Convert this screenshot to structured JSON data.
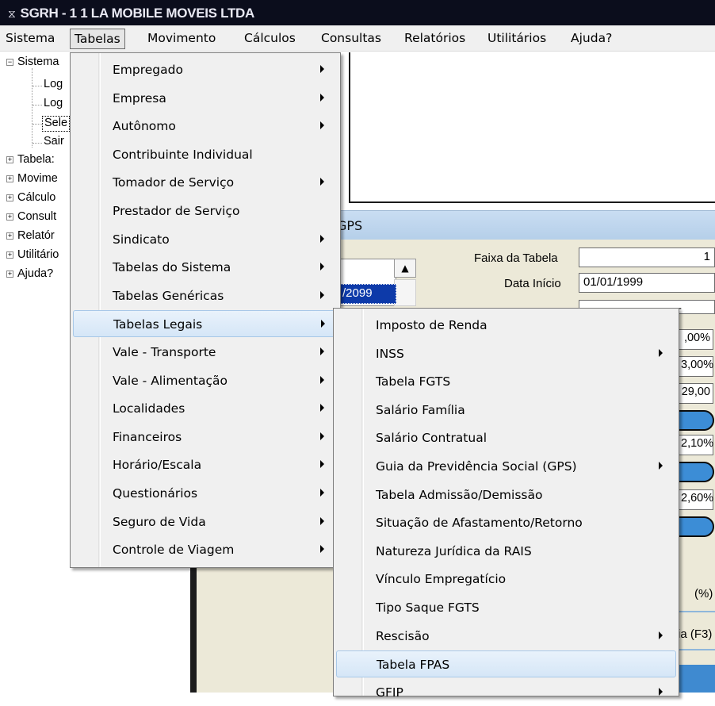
{
  "window": {
    "title": "SGRH - 1 1 LA MOBILE MOVEIS LTDA",
    "icon": "app-icon"
  },
  "menubar": [
    "Sistema",
    "Tabelas",
    "Movimento",
    "Cálculos",
    "Consultas",
    "Relatórios",
    "Utilitários",
    "Ajuda?"
  ],
  "tree": {
    "root": "Sistema",
    "children": [
      "Log",
      "Log",
      "Sele",
      "Sair"
    ],
    "nodes": [
      "Tabela:",
      "Movime",
      "Cálculo",
      "Consult",
      "Relatór",
      "Utilitário",
      "Ajuda?"
    ]
  },
  "gps_window": {
    "title_fragment": "GPS",
    "faixa_label": "Faixa da Tabela",
    "faixa_value": "1",
    "data_inicio_label": "Data Início",
    "data_inicio_value": "01/01/1999",
    "list_selected": "/2099",
    "dash": "-",
    "pct_values": [
      ",00%",
      "3,00%",
      "29,00",
      "2,10%",
      "2,60%"
    ],
    "pct_header": "(%)",
    "f3_button": "ia (F3)"
  },
  "tabelas_menu": {
    "items": [
      {
        "label": "Empregado",
        "submenu": true
      },
      {
        "label": "Empresa",
        "submenu": true
      },
      {
        "label": "Autônomo",
        "submenu": true
      },
      {
        "label": "Contribuinte Individual",
        "submenu": false
      },
      {
        "label": "Tomador de Serviço",
        "submenu": true
      },
      {
        "label": "Prestador de Serviço",
        "submenu": false
      },
      {
        "label": "Sindicato",
        "submenu": true
      },
      {
        "label": "Tabelas do Sistema",
        "submenu": true
      },
      {
        "label": "Tabelas Genéricas",
        "submenu": true
      },
      {
        "label": "Tabelas Legais",
        "submenu": true,
        "highlighted": true
      },
      {
        "label": "Vale - Transporte",
        "submenu": true
      },
      {
        "label": "Vale - Alimentação",
        "submenu": true
      },
      {
        "label": "Localidades",
        "submenu": true
      },
      {
        "label": "Financeiros",
        "submenu": true
      },
      {
        "label": "Horário/Escala",
        "submenu": true
      },
      {
        "label": "Questionários",
        "submenu": true
      },
      {
        "label": "Seguro de Vida",
        "submenu": true
      },
      {
        "label": "Controle de Viagem",
        "submenu": true
      }
    ]
  },
  "tabelas_legais_menu": {
    "items": [
      {
        "label": "Imposto de Renda",
        "submenu": false
      },
      {
        "label": "INSS",
        "submenu": true
      },
      {
        "label": "Tabela FGTS",
        "submenu": false
      },
      {
        "label": "Salário Família",
        "submenu": false
      },
      {
        "label": "Salário Contratual",
        "submenu": false
      },
      {
        "label": "Guia da Previdência Social (GPS)",
        "submenu": true
      },
      {
        "label": "Tabela Admissão/Demissão",
        "submenu": false
      },
      {
        "label": "Situação de Afastamento/Retorno",
        "submenu": false
      },
      {
        "label": "Natureza Jurídica da RAIS",
        "submenu": false
      },
      {
        "label": "Vínculo Empregatício",
        "submenu": false
      },
      {
        "label": "Tipo Saque FGTS",
        "submenu": false
      },
      {
        "label": "Rescisão",
        "submenu": true
      },
      {
        "label": "Tabela FPAS",
        "submenu": false,
        "highlighted": true
      },
      {
        "label": "GFIP",
        "submenu": true
      }
    ]
  },
  "colors": {
    "titlebar": "#0b0d1c",
    "highlight": "#d5e6f7",
    "selection": "#0d3aa9",
    "accent_blue": "#3c8dd6"
  }
}
